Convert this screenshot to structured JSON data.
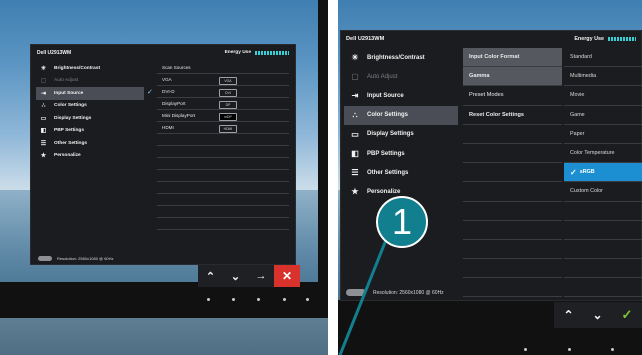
{
  "left_osd": {
    "model": "Dell U2913WM",
    "energy_label": "Energy Use",
    "menu": [
      {
        "icon": "brightness-icon",
        "label": "Brightness/Contrast",
        "state": "normal"
      },
      {
        "icon": "auto-adjust-icon",
        "label": "Auto Adjust",
        "state": "dim"
      },
      {
        "icon": "input-source-icon",
        "label": "Input Source",
        "state": "selected"
      },
      {
        "icon": "color-settings-icon",
        "label": "Color Settings",
        "state": "normal"
      },
      {
        "icon": "display-settings-icon",
        "label": "Display Settings",
        "state": "normal"
      },
      {
        "icon": "pbp-settings-icon",
        "label": "PBP Settings",
        "state": "normal"
      },
      {
        "icon": "other-settings-icon",
        "label": "Other Settings",
        "state": "normal"
      },
      {
        "icon": "personalize-icon",
        "label": "Personalize",
        "state": "normal"
      }
    ],
    "submenu": [
      {
        "label": "Scan Sources",
        "badge": "",
        "checked": false
      },
      {
        "label": "VGA",
        "badge": "VGA",
        "checked": false
      },
      {
        "label": "DVI-D",
        "badge": "DVI",
        "checked": true
      },
      {
        "label": "DisplayPort",
        "badge": "DP",
        "checked": false
      },
      {
        "label": "Mini DisplayPort",
        "badge": "mDP",
        "checked": false
      },
      {
        "label": "HDMI",
        "badge": "HDMI",
        "checked": false
      }
    ],
    "resolution": "Resolution: 2560x1080 @ 60Hz",
    "buttons": [
      "up",
      "down",
      "right",
      "close"
    ]
  },
  "right_osd": {
    "model": "Dell U2913WM",
    "energy_label": "Energy Use",
    "menu": [
      {
        "icon": "brightness-icon",
        "label": "Brightness/Contrast",
        "state": "normal"
      },
      {
        "icon": "auto-adjust-icon",
        "label": "Auto Adjust",
        "state": "dim"
      },
      {
        "icon": "input-source-icon",
        "label": "Input Source",
        "state": "normal"
      },
      {
        "icon": "color-settings-icon",
        "label": "Color Settings",
        "state": "selected"
      },
      {
        "icon": "display-settings-icon",
        "label": "Display Settings",
        "state": "normal"
      },
      {
        "icon": "pbp-settings-icon",
        "label": "PBP Settings",
        "state": "normal"
      },
      {
        "icon": "other-settings-icon",
        "label": "Other Settings",
        "state": "normal"
      },
      {
        "icon": "personalize-icon",
        "label": "Personalize",
        "state": "normal"
      }
    ],
    "submenu": [
      {
        "label": "Input Color Format",
        "bold": true
      },
      {
        "label": "Gamma",
        "bold": true
      },
      {
        "label": "Preset Modes",
        "bold": false
      },
      {
        "label": "Reset Color Settings",
        "bold": true
      }
    ],
    "preset_modes": [
      {
        "label": "Standard",
        "selected": false
      },
      {
        "label": "Multimedia",
        "selected": false
      },
      {
        "label": "Movie",
        "selected": false
      },
      {
        "label": "Game",
        "selected": false
      },
      {
        "label": "Paper",
        "selected": false
      },
      {
        "label": "Color Temperature",
        "selected": false
      },
      {
        "label": "sRGB",
        "selected": true
      },
      {
        "label": "Custom Color",
        "selected": false
      }
    ],
    "resolution": "Resolution: 2560x1080 @ 60Hz",
    "buttons": [
      "up",
      "down",
      "ok"
    ]
  },
  "callout": {
    "number": "1"
  },
  "colors": {
    "osd_bg": "#1b1c1f",
    "selection": "#4a4d55",
    "highlight_blue": "#1c8fd3",
    "callout_teal": "#127f8e",
    "close_red": "#d9322c"
  }
}
